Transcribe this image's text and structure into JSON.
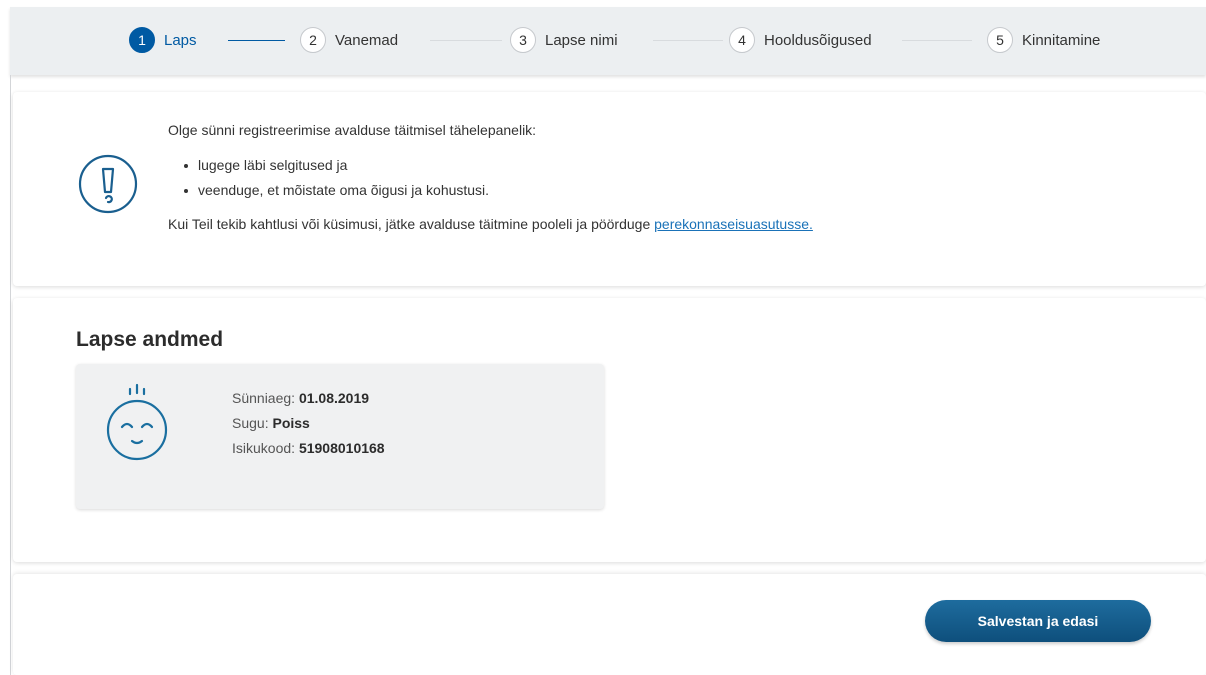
{
  "stepper": {
    "steps": [
      {
        "number": "1",
        "label": "Laps",
        "active": true
      },
      {
        "number": "2",
        "label": "Vanemad",
        "active": false
      },
      {
        "number": "3",
        "label": "Lapse nimi",
        "active": false
      },
      {
        "number": "4",
        "label": "Hooldusõigused",
        "active": false
      },
      {
        "number": "5",
        "label": "Kinnitamine",
        "active": false
      }
    ],
    "active_color": "#005aa3"
  },
  "notice": {
    "icon": "exclamation-circle-icon",
    "intro": "Olge sünni registreerimise avalduse täitmisel tähelepanelik:",
    "items": [
      "lugege läbi selgitused ja",
      "veenduge, et mõistate oma õigusi ja kohustusi."
    ],
    "footer_text": "Kui Teil tekib kahtlusi või küsimusi, jätke avalduse täitmine pooleli ja pöörduge ",
    "footer_link": "perekonnaseisuasutusse."
  },
  "child": {
    "section_title": "Lapse andmed",
    "icon": "baby-face-icon",
    "birth_date_label": "Sünniaeg: ",
    "birth_date": "01.08.2019",
    "gender_label": "Sugu: ",
    "gender": "Poiss",
    "id_code_label": "Isikukood: ",
    "id_code": "51908010168"
  },
  "actions": {
    "save_label": "Salvestan ja edasi",
    "button_color": "#125c8c"
  }
}
